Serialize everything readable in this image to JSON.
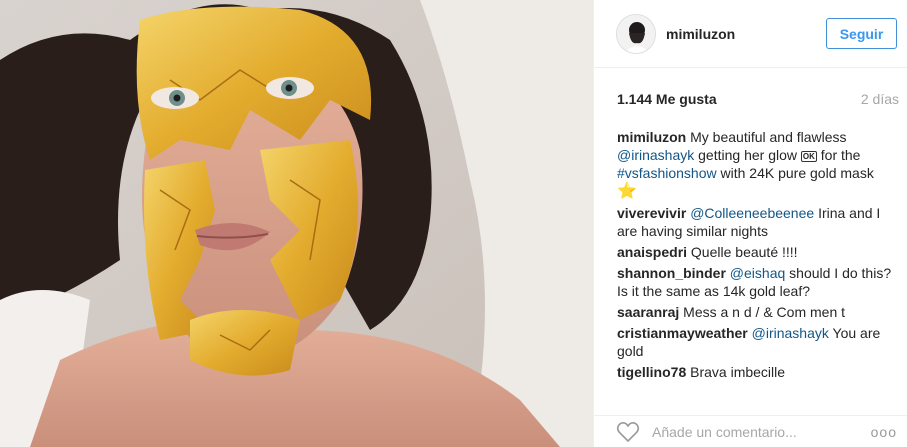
{
  "header": {
    "username": "mimiluzon",
    "follow_label": "Seguir"
  },
  "meta": {
    "likes": "1.144 Me gusta",
    "time": "2 días"
  },
  "caption": {
    "author": "mimiluzon",
    "text1": "My beautiful and flawless",
    "mention": "@irinashayk",
    "text2": "getting her glow",
    "emoji_ok": "OK",
    "text3": "for the",
    "hashtag": "#vsfashionshow",
    "text4": "with 24K pure gold mask",
    "star": "⭐"
  },
  "comments": [
    {
      "author": "viverevivir",
      "mention": "@Colleeneebeenee",
      "text": "Irina and I are having similar nights"
    },
    {
      "author": "anaispedri",
      "mention": "",
      "text": "Quelle beauté !!!!"
    },
    {
      "author": "shannon_binder",
      "mention": "@eishaq",
      "text": "should I do this? Is it the same as 14k gold leaf?"
    },
    {
      "author": "saaranraj",
      "mention": "",
      "text": "Mess a n d / & Com men t"
    },
    {
      "author": "cristianmayweather",
      "mention": "@irinashayk",
      "text": "You are gold"
    },
    {
      "author": "tigellino78",
      "mention": "",
      "text": "Brava imbecille"
    }
  ],
  "footer": {
    "placeholder": "Añade un comentario...",
    "more": "ooo"
  },
  "colors": {
    "follow_border": "#4090db",
    "mention": "#125688",
    "gold": "#e7b43a"
  }
}
